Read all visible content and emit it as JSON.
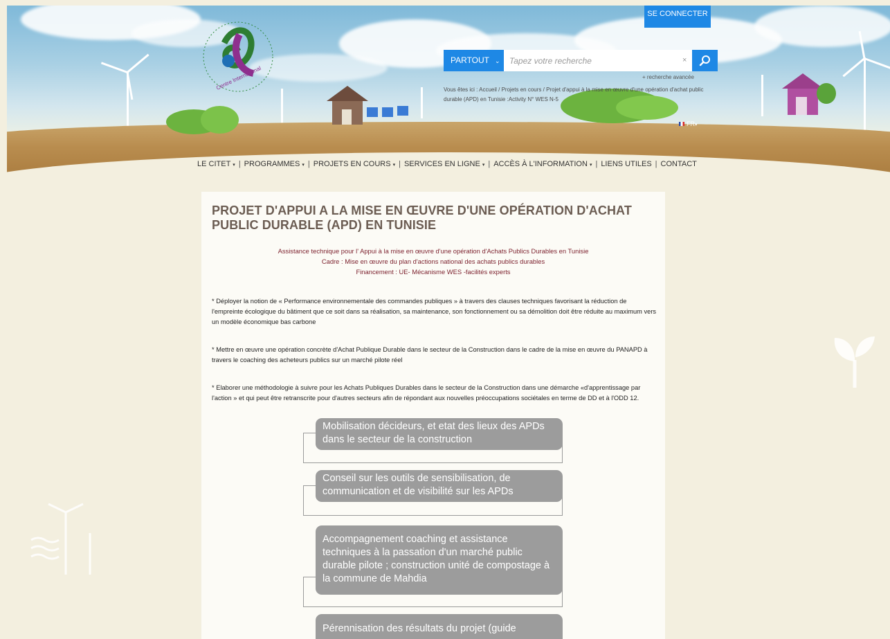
{
  "header": {
    "connect_label": "SE CONNECTER",
    "search": {
      "scope_label": "PARTOUT",
      "placeholder": "Tapez votre recherche",
      "clear_label": "×"
    },
    "advanced_label": "+ recherche avancée",
    "breadcrumb": "Vous êtes ici :  Accueil / Projets en cours / Projet d'appui à la mise en œuvre d'une opération d'achat public durable (APD) en Tunisie :Activity N° WES N-5",
    "language": "FR"
  },
  "nav": {
    "items": [
      {
        "label": "LE CITET",
        "dropdown": true
      },
      {
        "label": "PROGRAMMES",
        "dropdown": true
      },
      {
        "label": "PROJETS EN COURS",
        "dropdown": true
      },
      {
        "label": "SERVICES EN LIGNE",
        "dropdown": true
      },
      {
        "label": "ACCÈS À L'INFORMATION",
        "dropdown": true
      },
      {
        "label": "LIENS UTILES",
        "dropdown": false
      },
      {
        "label": "CONTACT",
        "dropdown": false
      }
    ]
  },
  "article": {
    "title": "PROJET D'APPUI A LA MISE EN ŒUVRE D'UNE OPÉRATION D'ACHAT PUBLIC DURABLE (APD) EN TUNISIE",
    "subtitle_lines": [
      "Assistance technique pour l' Appui à la mise en œuvre d'une opération d'Achats Publics Durables en Tunisie",
      "Cadre  : Mise en œuvre du plan d'actions national des achats publics durables",
      "Financement : UE- Mécanisme WES  -facilités experts"
    ],
    "paragraphs": [
      "* Déployer la notion de « Performance environnementale des commandes publiques » à travers des clauses techniques favorisant la réduction de l'empreinte écologique du bâtiment que ce soit dans sa réalisation, sa maintenance, son fonctionnement ou sa démolition doit être réduite au maximum vers un modèle  économique bas carbone",
      "* Mettre en œuvre une opération concrète d'Achat Publique Durable dans le secteur de la Construction dans le cadre de la mise en œuvre du PANAPD à travers le coaching des acheteurs publics sur un marché pilote réel",
      "* Elaborer une méthodologie à suivre pour les Achats Publiques Durables dans le secteur de la Construction dans une démarche «d'apprentissage par l'action » et qui peut être retranscrite pour d'autres secteurs afin de répondant aux nouvelles préoccupations sociétales en terme de DD et à l'ODD 12."
    ],
    "steps": [
      "Mobilisation décideurs, et etat des lieux des APDs dans le secteur de la construction",
      "Conseil sur les outils de sensibilisation, de communication et de visibilité sur les APDs",
      "Accompagnement  coaching et assistance techniques  à la passation d'un marché public durable pilote ; construction unité de compostage  à la commune de  Mahdia",
      "Pérennisation des résultats du projet (guide"
    ]
  },
  "colors": {
    "accent_blue": "#1e88e5",
    "title_brown": "#6b5c52",
    "subtitle_red": "#7b1f2c",
    "step_grey": "#9c9c9c",
    "page_bg": "#f3efdf"
  },
  "icons": [
    "search-icon",
    "chevron-down-icon",
    "flag-fr-icon",
    "logo-citet",
    "seedling-icon",
    "wind-turbine-icon"
  ]
}
